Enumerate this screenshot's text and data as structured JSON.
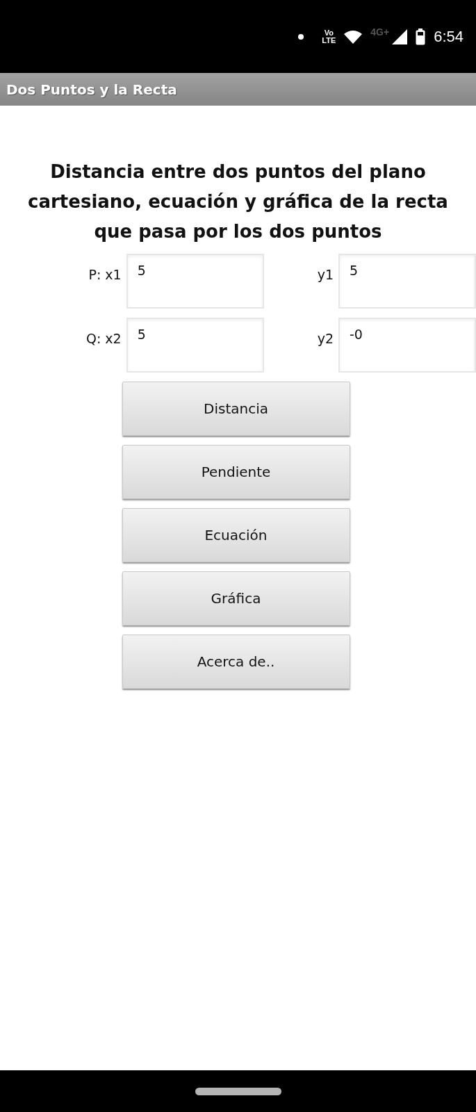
{
  "status_bar": {
    "volte_top": "Vo",
    "volte_bottom": "LTE",
    "network": "4G+",
    "time": "6:54"
  },
  "app_bar": {
    "title": "Dos Puntos y la Recta"
  },
  "heading": "Distancia entre dos puntos del plano cartesiano, ecuación y gráfica de la recta que pasa por los dos puntos",
  "point_rows": [
    {
      "point_label": "P:",
      "fields": [
        {
          "label": "x1",
          "value": "5"
        },
        {
          "label": "y1",
          "value": "5"
        }
      ]
    },
    {
      "point_label": "Q:",
      "fields": [
        {
          "label": "x2",
          "value": "5"
        },
        {
          "label": "y2",
          "value": "-0"
        }
      ]
    }
  ],
  "buttons": [
    "Distancia",
    "Pendiente",
    "Ecuación",
    "Gráfica",
    "Acerca de.."
  ]
}
